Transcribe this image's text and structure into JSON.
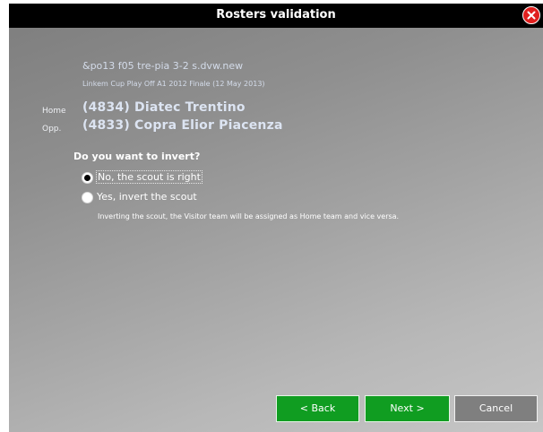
{
  "window": {
    "title": "Rosters validation"
  },
  "scout": {
    "file": "&po13 f05 tre-pia 3-2 s.dvw.new",
    "match": "Linkem Cup Play Off A1 2012 Finale (12 May 2013)",
    "home_label": "Home",
    "home_team": "(4834) Diatec Trentino",
    "opp_label": "Opp.",
    "opp_team": "(4833) Copra Elior Piacenza"
  },
  "question": {
    "text": "Do you want to invert?",
    "options": [
      {
        "label": "No, the scout is right",
        "selected": true
      },
      {
        "label": "Yes, invert the scout",
        "selected": false
      }
    ],
    "note": "Inverting the scout, the Visitor team will be assigned as Home team and vice versa."
  },
  "buttons": {
    "back": "< Back",
    "next": "Next >",
    "cancel": "Cancel"
  },
  "colors": {
    "title_bar": "#000000",
    "close": "#e0201f",
    "primary_button": "#109d21",
    "secondary_button": "#7f7f7f"
  },
  "icons": {
    "close": "close-icon"
  }
}
